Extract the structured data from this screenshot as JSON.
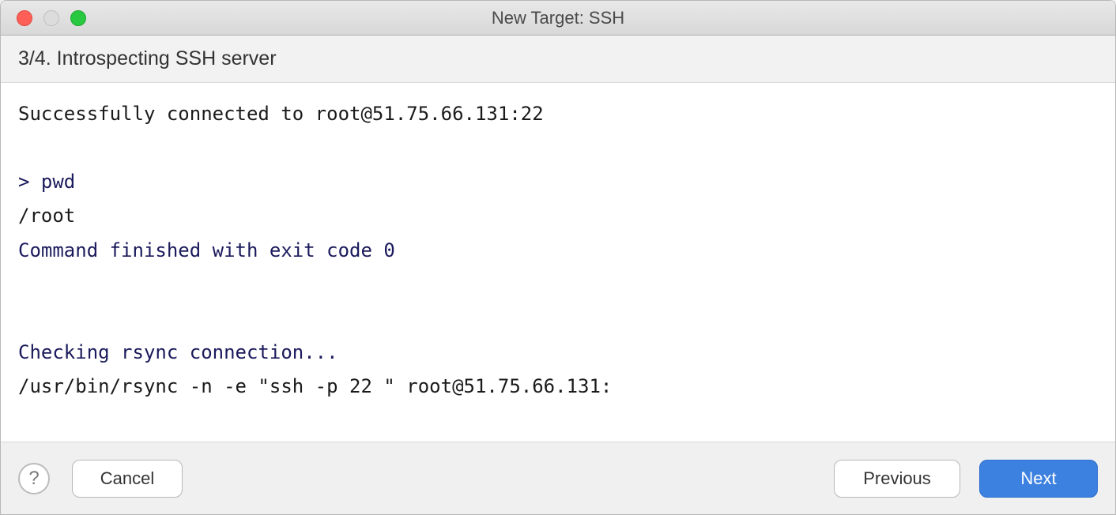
{
  "window": {
    "title": "New Target: SSH"
  },
  "step": {
    "label": "3/4. Introspecting SSH server"
  },
  "terminal": {
    "connected": "Successfully connected to root@51.75.66.131:22",
    "cmd_pwd": "> pwd",
    "out_pwd": "/root",
    "exit0": "Command finished with exit code 0",
    "rsync_check": "Checking rsync connection...",
    "rsync_cmd": "/usr/bin/rsync -n -e \"ssh -p 22 \" root@51.75.66.131:"
  },
  "buttons": {
    "help": "?",
    "cancel": "Cancel",
    "previous": "Previous",
    "next": "Next"
  }
}
